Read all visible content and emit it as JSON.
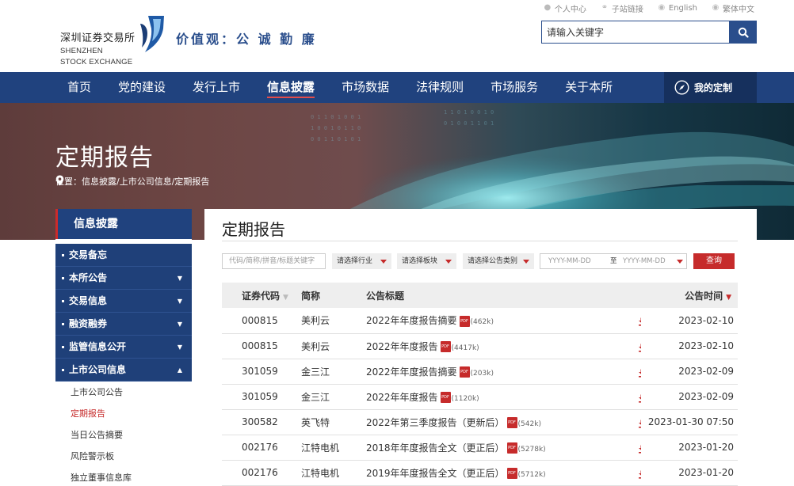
{
  "header": {
    "logo_cn": "深圳证券交易所",
    "logo_en_1": "SHENZHEN",
    "logo_en_2": "STOCK EXCHANGE",
    "motto": "价值观：公 诚 勤 廉",
    "top_links": [
      "个人中心",
      "子站链接",
      "English",
      "繁体中文"
    ],
    "search_placeholder": "请输入关键字"
  },
  "nav": {
    "items": [
      "首页",
      "党的建设",
      "发行上市",
      "信息披露",
      "市场数据",
      "法律规则",
      "市场服务",
      "关于本所"
    ],
    "active": "信息披露",
    "custom_label": "我的定制"
  },
  "banner": {
    "title": "定期报告",
    "breadcrumb": "位置：信息披露/上市公司信息/定期报告"
  },
  "sidebar": {
    "heading": "信息披露",
    "items": [
      "交易备忘",
      "本所公告",
      "交易信息",
      "融资融券",
      "监管信息公开",
      "上市公司信息"
    ],
    "sub_items": [
      "上市公司公告",
      "定期报告",
      "当日公告摘要",
      "风险警示板",
      "独立董事信息库"
    ],
    "active_sub": "定期报告"
  },
  "main": {
    "title": "定期报告",
    "filters": {
      "search_placeholder": "代码/简称/拼音/标题关键字",
      "industry": "请选择行业",
      "board": "请选择板块",
      "category": "请选择公告类别",
      "date_from": "YYYY-MM-DD",
      "date_sep": "至",
      "date_to": "YYYY-MM-DD",
      "query": "查询"
    },
    "columns": {
      "code": "证券代码",
      "name": "简称",
      "title": "公告标题",
      "time": "公告时间"
    },
    "rows": [
      {
        "code": "000815",
        "name": "美利云",
        "title": "2022年年度报告摘要",
        "size": "(462k)",
        "time": "2023-02-10"
      },
      {
        "code": "000815",
        "name": "美利云",
        "title": "2022年年度报告",
        "size": "(4417k)",
        "time": "2023-02-10"
      },
      {
        "code": "301059",
        "name": "金三江",
        "title": "2022年年度报告摘要",
        "size": "(203k)",
        "time": "2023-02-09"
      },
      {
        "code": "301059",
        "name": "金三江",
        "title": "2022年年度报告",
        "size": "(1120k)",
        "time": "2023-02-09"
      },
      {
        "code": "300582",
        "name": "英飞特",
        "title": "2022年第三季度报告（更新后）",
        "size": "(542k)",
        "time": "2023-01-30 07:50"
      },
      {
        "code": "002176",
        "name": "江特电机",
        "title": "2018年年度报告全文（更正后）",
        "size": "(5278k)",
        "time": "2023-01-20"
      },
      {
        "code": "002176",
        "name": "江特电机",
        "title": "2019年年度报告全文（更正后）",
        "size": "(5712k)",
        "time": "2023-01-20"
      }
    ]
  },
  "colors": {
    "brand_blue": "#20427e",
    "accent_red": "#c62b2b"
  }
}
